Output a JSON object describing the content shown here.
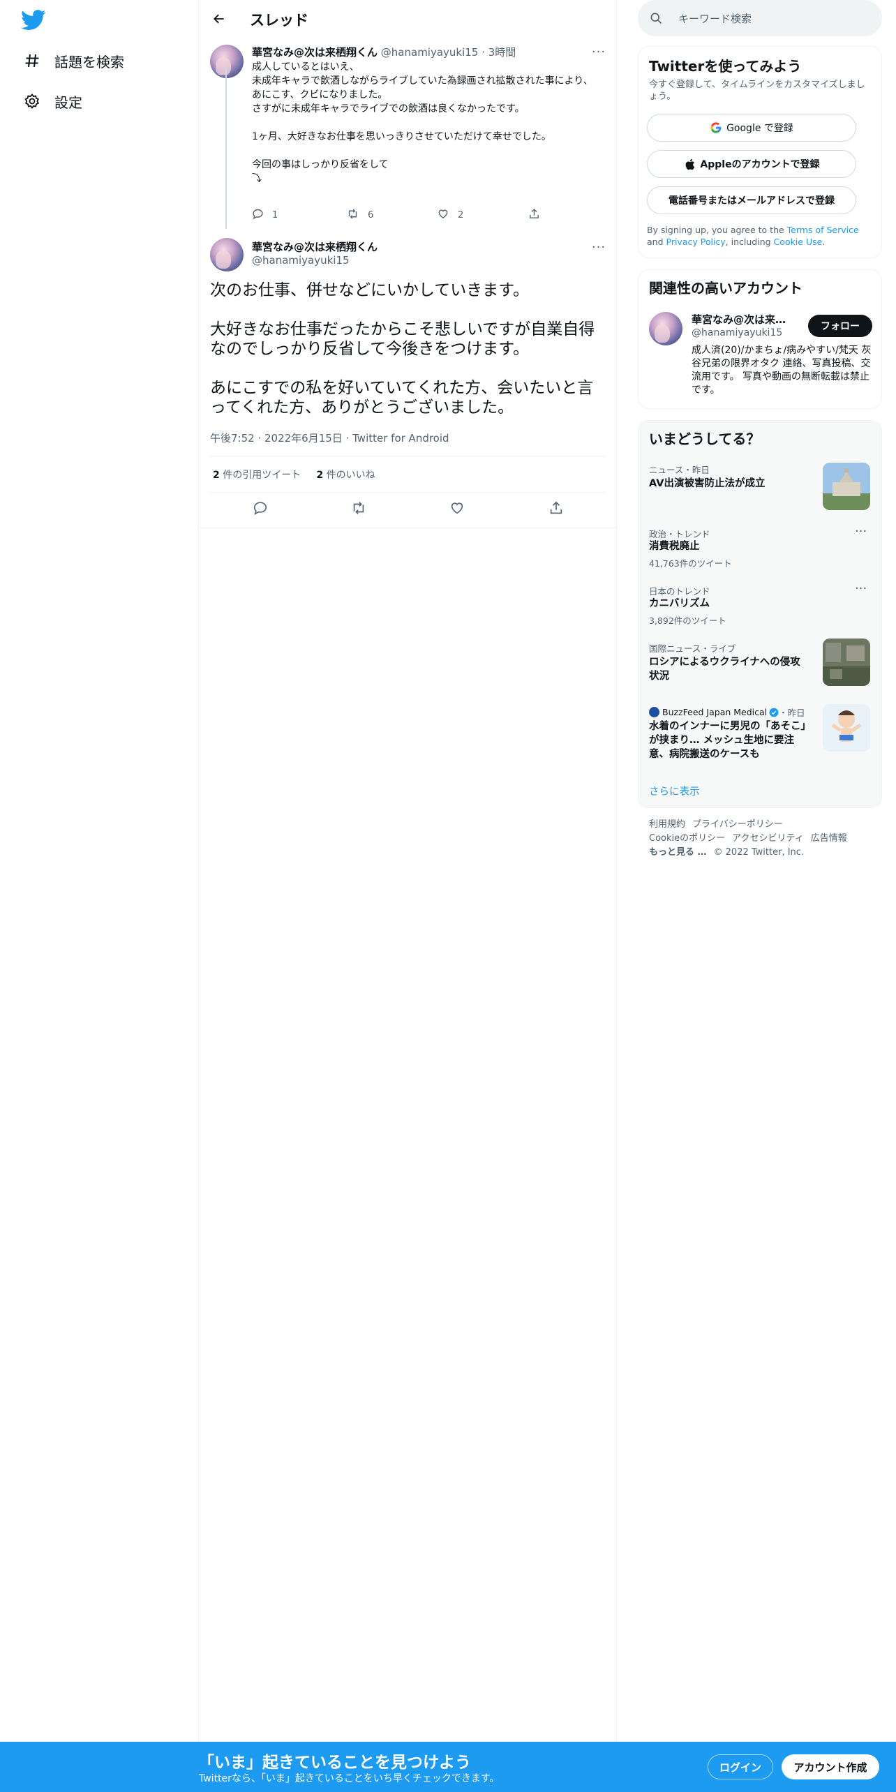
{
  "nav": {
    "items": [
      {
        "label": "話題を検索",
        "icon": "hashtag-icon"
      },
      {
        "label": "設定",
        "icon": "gear-icon"
      }
    ]
  },
  "header": {
    "title": "スレッド"
  },
  "parent_tweet": {
    "name": "華宮なみ@次は来栖翔くん",
    "handle": "@hanamiyayuki15",
    "time": "3時間",
    "lines": [
      "成人しているとはいえ、",
      "未成年キャラで飲酒しながらライブしていた為録画され拡散された事により、",
      "あにこす、クビになりました。",
      "さすがに未成年キャラでライブでの飲酒は良くなかったです。",
      "",
      "1ヶ月、大好きなお仕事を思いっきりさせていただけて幸せでした。",
      "",
      "今回の事はしっかり反省をして",
      "⤵︎"
    ],
    "reply_count": "1",
    "retweet_count": "6",
    "like_count": "2"
  },
  "main_tweet": {
    "name": "華宮なみ@次は来栖翔くん",
    "handle": "@hanamiyayuki15",
    "lines": [
      "次のお仕事、併せなどにいかしていきます。",
      "",
      "大好きなお仕事だったからこそ悲しいですが自業自得なのでしっかり反省して今後きをつけます。",
      "",
      "あにこすでの私を好いていてくれた方、会いたいと言ってくれた方、ありがとうございました。"
    ],
    "time": "午後7:52",
    "date": "2022年6月15日",
    "source": "Twitter for Android",
    "quote_count": "2",
    "quote_label": "件の引用ツイート",
    "like_count": "2",
    "like_label": "件のいいね"
  },
  "search": {
    "placeholder": "キーワード検索"
  },
  "signup": {
    "title": "Twitterを使ってみよう",
    "subtitle": "今すぐ登録して、タイムラインをカスタマイズしましょう。",
    "google_btn": "Google で登録",
    "apple_btn": "Appleのアカウントで登録",
    "phone_btn": "電話番号またはメールアドレスで登録",
    "terms_prefix": "By signing up, you agree to the ",
    "terms_link": "Terms of Service",
    "terms_and": " and ",
    "privacy_link": "Privacy Policy",
    "terms_incl": ", including ",
    "cookie_link": "Cookie Use",
    "terms_end": "."
  },
  "related": {
    "title": "関連性の高いアカウント",
    "name": "華宮なみ@次は来栖翔くん",
    "handle": "@hanamiyayuki15",
    "follow_label": "フォロー",
    "bio": "成人済(20)/かまちょ/病みやすい/梵天 灰谷兄弟の限界オタク 連絡、写真投稿、交流用です。 写真や動画の無断転載は禁止です。"
  },
  "trends": {
    "title": "いまどうしてる？",
    "items": [
      {
        "context": "ニュース・昨日",
        "title": "AV出演被害防止法が成立",
        "count": ""
      },
      {
        "context": "政治・トレンド",
        "title": "消費税廃止",
        "count": "41,763件のツイート"
      },
      {
        "context": "日本のトレンド",
        "title": "カニバリズム",
        "count": "3,892件のツイート"
      },
      {
        "context": "国際ニュース・ライブ",
        "title": "ロシアによるウクライナへの侵攻状況",
        "count": ""
      },
      {
        "context_source": "BuzzFeed Japan Medical",
        "context_time": "・昨日",
        "title": "水着のインナーに男児の「あそこ」が挟まり… メッシュ生地に要注意、病院搬送のケースも",
        "count": ""
      }
    ],
    "show_more": "さらに表示"
  },
  "footer": {
    "links": [
      "利用規約",
      "プライバシーポリシー",
      "Cookieのポリシー",
      "アクセシビリティ",
      "広告情報",
      "もっと見る …"
    ],
    "copyright": "© 2022 Twitter, Inc."
  },
  "bottom_bar": {
    "title": "「いま」起きていることを見つけよう",
    "subtitle": "Twitterなら、「いま」起きていることをいち早くチェックできます。",
    "login": "ログイン",
    "signup": "アカウント作成"
  },
  "colors": {
    "accent": "#1d9bf0",
    "text": "#0f1419",
    "muted": "#536471",
    "border": "#eff3f4"
  }
}
